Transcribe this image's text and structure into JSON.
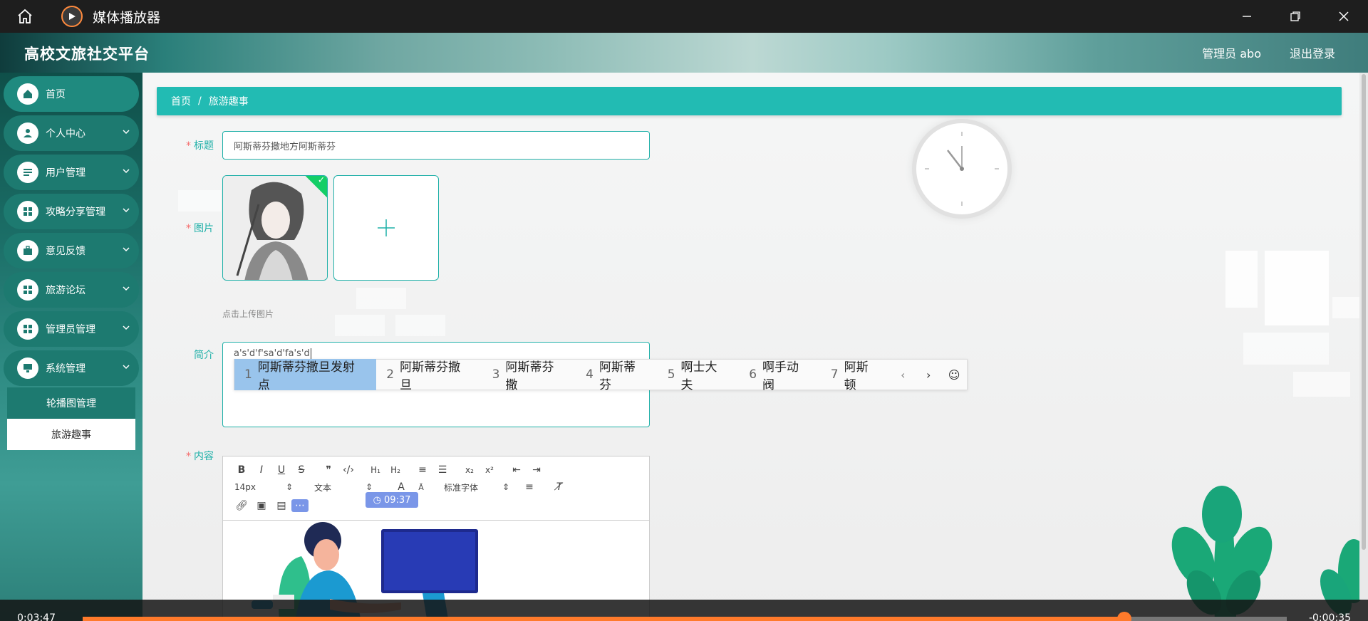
{
  "player": {
    "title": "媒体播放器",
    "time_elapsed": "0:03:47",
    "time_remaining": "-0:00:35",
    "progress_percent": 86.5
  },
  "app": {
    "title": "高校文旅社交平台",
    "user": "管理员 abo",
    "logout": "退出登录"
  },
  "sidebar": {
    "items": [
      {
        "label": "首页",
        "icon": "home-icon"
      },
      {
        "label": "个人中心",
        "icon": "user-icon"
      },
      {
        "label": "用户管理",
        "icon": "list-icon"
      },
      {
        "label": "攻略分享管理",
        "icon": "grid-icon"
      },
      {
        "label": "意见反馈",
        "icon": "briefcase-icon"
      },
      {
        "label": "旅游论坛",
        "icon": "grid-icon"
      },
      {
        "label": "管理员管理",
        "icon": "grid-icon"
      },
      {
        "label": "系统管理",
        "icon": "monitor-icon"
      }
    ],
    "submenu": [
      "轮播图管理",
      "旅游趣事"
    ]
  },
  "breadcrumb": {
    "home": "首页",
    "separator": "/",
    "current": "旅游趣事"
  },
  "form": {
    "title_label": "标题",
    "title_value": "阿斯蒂芬撒地方阿斯蒂芬",
    "image_label": "图片",
    "upload_tip": "点击上传图片",
    "intro_label": "简介",
    "intro_value": "a's'd'f'sa'd'fa's'd",
    "content_label": "内容"
  },
  "ime": {
    "candidates": [
      {
        "num": "1",
        "text": "阿斯蒂芬撒旦发射点"
      },
      {
        "num": "2",
        "text": "阿斯蒂芬撒旦"
      },
      {
        "num": "3",
        "text": "阿斯蒂芬撒"
      },
      {
        "num": "4",
        "text": "阿斯蒂芬"
      },
      {
        "num": "5",
        "text": "啊士大夫"
      },
      {
        "num": "6",
        "text": "啊手动阀"
      },
      {
        "num": "7",
        "text": "阿斯顿"
      }
    ]
  },
  "editor": {
    "font_size": "14px",
    "header_select": "文本",
    "font_family": "标准字体",
    "time_badge": "09:37"
  },
  "colors": {
    "accent": "#22bbb3",
    "sidebar": "#1d7a70",
    "progress": "#ff7a2b"
  }
}
